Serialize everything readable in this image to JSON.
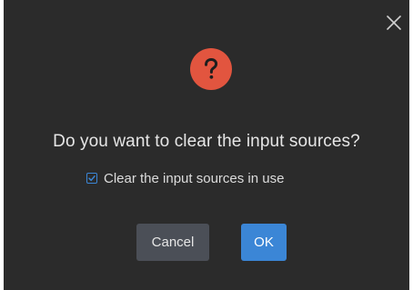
{
  "dialog": {
    "close_icon": "close-icon",
    "warning_icon": "question-mark-icon",
    "warning_color": "#e2553f",
    "accent_color": "#3b86d6",
    "title": "Do you want to clear the input sources?",
    "checkbox": {
      "label": "Clear the input sources in use",
      "checked": true
    },
    "buttons": {
      "cancel_label": "Cancel",
      "ok_label": "OK"
    }
  }
}
